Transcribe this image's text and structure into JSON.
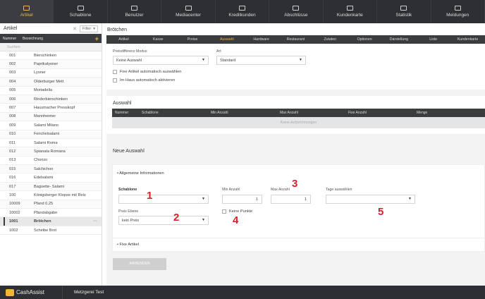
{
  "nav": [
    {
      "label": "Artikel",
      "icon": "box-icon"
    },
    {
      "label": "Schablone",
      "icon": "template-icon"
    },
    {
      "label": "Benutzer",
      "icon": "user-icon"
    },
    {
      "label": "Mediacenter",
      "icon": "media-icon"
    },
    {
      "label": "Kreditkunden",
      "icon": "credit-icon"
    },
    {
      "label": "Abschlüsse",
      "icon": "report-icon"
    },
    {
      "label": "Kundenkarte",
      "icon": "card-icon"
    },
    {
      "label": "Statistik",
      "icon": "chart-icon"
    },
    {
      "label": "Meldungen",
      "icon": "mail-icon"
    }
  ],
  "left": {
    "title": "Artikel",
    "filter": "Filter",
    "col_number": "Nummer",
    "col_name": "Bezeichnung",
    "search_placeholder": "Suchen",
    "items": [
      {
        "n": "001",
        "name": "Bierschinken"
      },
      {
        "n": "002",
        "name": "Paprikalyoner"
      },
      {
        "n": "003",
        "name": "Lyoner"
      },
      {
        "n": "004",
        "name": "Olderburger Mett"
      },
      {
        "n": "005",
        "name": "Mortadella"
      },
      {
        "n": "006",
        "name": "Rinderbierschinken"
      },
      {
        "n": "007",
        "name": "Hausmacher Presskopf"
      },
      {
        "n": "008",
        "name": "Mannheimer"
      },
      {
        "n": "009",
        "name": "Salami Milano"
      },
      {
        "n": "010",
        "name": "Fenchelsalami"
      },
      {
        "n": "011",
        "name": "Salami Roma"
      },
      {
        "n": "012",
        "name": "Spianata Romana"
      },
      {
        "n": "013",
        "name": "Chorizo"
      },
      {
        "n": "015",
        "name": "Salchichon"
      },
      {
        "n": "016",
        "name": "Edelsalami"
      },
      {
        "n": "017",
        "name": "Baguette- Salami"
      },
      {
        "n": "100",
        "name": "Königsberger Klopse mit Reis"
      },
      {
        "n": "10009",
        "name": "Pfand 0,25"
      },
      {
        "n": "10002",
        "name": "Pfandabgabe"
      },
      {
        "n": "1001",
        "name": "Brötchen"
      },
      {
        "n": "1002",
        "name": "Scheibe Brot"
      }
    ],
    "selected_index": 19
  },
  "main": {
    "title": "Brötchen",
    "tabs": [
      "Artikel",
      "Kasse",
      "Preise",
      "Auswahl",
      "Hardware",
      "Restaurant",
      "Zutaten",
      "Optionen",
      "Darstellung",
      "Liste",
      "Kundenkarte"
    ],
    "active_tab": 3,
    "preisdiff_label": "Preisdifferenz Modus",
    "preisdiff_value": "Keine Auswahl",
    "art_label": "Art",
    "art_value": "Standard",
    "chk_fixe": "Fixe Artikel automatisch auswählen",
    "chk_imhaus": "Im-Haus automatisch aktivieren",
    "auswahl_title": "Auswahl",
    "table_cols": [
      "Nummer",
      "Schablone",
      "Min Anzahl",
      "Max Anzahl",
      "Fixe Anzahl",
      "Menge"
    ],
    "empty_text": "Keine Aufzeichnungen",
    "neue_title": "Neue Auswahl",
    "allg_info": "Allgemeine Informationen",
    "schablone_label": "Schablone",
    "min_label": "Min Anzahl",
    "min_value": "1",
    "max_label": "Max Anzahl",
    "max_value": "1",
    "tage_label": "Tage auswählen",
    "preis_label": "Preis Ebene",
    "preis_value": "kein Preis",
    "keine_punkte": "Keine Punkte",
    "fixe_artikel": "Fixe Artikel",
    "apply": "ANWENDEN",
    "markers": [
      "1",
      "2",
      "3",
      "4",
      "5"
    ]
  },
  "bottom": {
    "logo": "CashAssist",
    "store": "Metzgerei Test"
  },
  "colors": {
    "accent": "#f2b736",
    "dark": "#2d2f33",
    "marker": "#d6202a"
  }
}
